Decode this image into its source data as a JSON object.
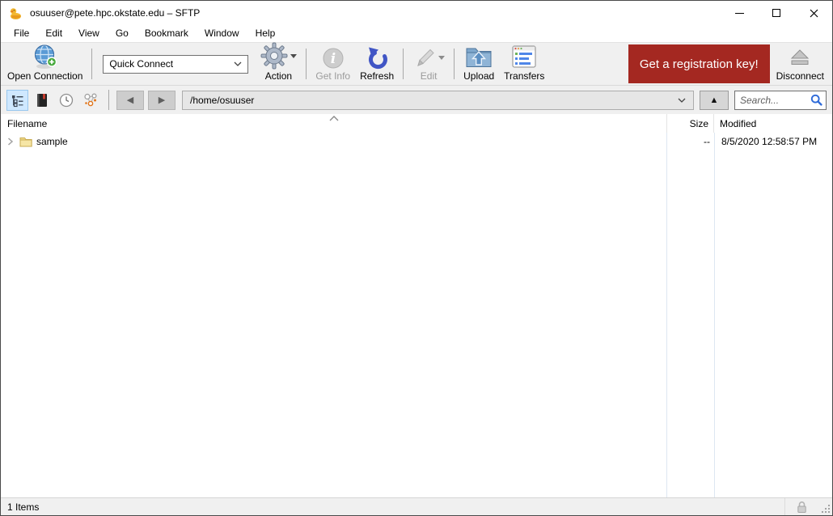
{
  "window": {
    "title": "osuuser@pete.hpc.okstate.edu – SFTP"
  },
  "menu": {
    "items": [
      "File",
      "Edit",
      "View",
      "Go",
      "Bookmark",
      "Window",
      "Help"
    ]
  },
  "toolbar": {
    "open_connection_label": "Open Connection",
    "quick_connect_value": "Quick Connect",
    "action_label": "Action",
    "get_info_label": "Get Info",
    "refresh_label": "Refresh",
    "edit_label": "Edit",
    "upload_label": "Upload",
    "transfers_label": "Transfers",
    "registration_label": "Get a registration key!",
    "disconnect_label": "Disconnect"
  },
  "navbar": {
    "path_value": "/home/osuuser",
    "search_placeholder": "Search..."
  },
  "browser": {
    "columns": {
      "filename": "Filename",
      "size": "Size",
      "modified": "Modified"
    },
    "rows": [
      {
        "name": "sample",
        "size": "--",
        "modified": "8/5/2020 12:58:57 PM"
      }
    ]
  },
  "statusbar": {
    "items_count": "1 Items"
  },
  "icons": {
    "app": "rubber-duck",
    "open_connection": "globe-plus",
    "action": "gear",
    "get_info": "info-circle",
    "refresh": "circular-arrow",
    "edit": "pencil",
    "upload": "folder-up-arrow",
    "transfers": "transfer-window",
    "disconnect": "eject",
    "view_outline": "outline-tree",
    "view_bookmarks": "book",
    "view_history": "clock",
    "view_bonjour": "bonjour",
    "search": "magnifier",
    "row_folder": "folder",
    "status_lock": "padlock"
  },
  "colors": {
    "registration_bg": "#a42821",
    "registration_text": "#ffffff",
    "toolbar_bg": "#f0f0f0",
    "selected_view_bg": "#cfe8ff",
    "column_divider": "#dde7f1",
    "refresh_blue": "#4156c5",
    "search_blue": "#2f6bd8",
    "folder_yellow": "#f2dc8c"
  }
}
